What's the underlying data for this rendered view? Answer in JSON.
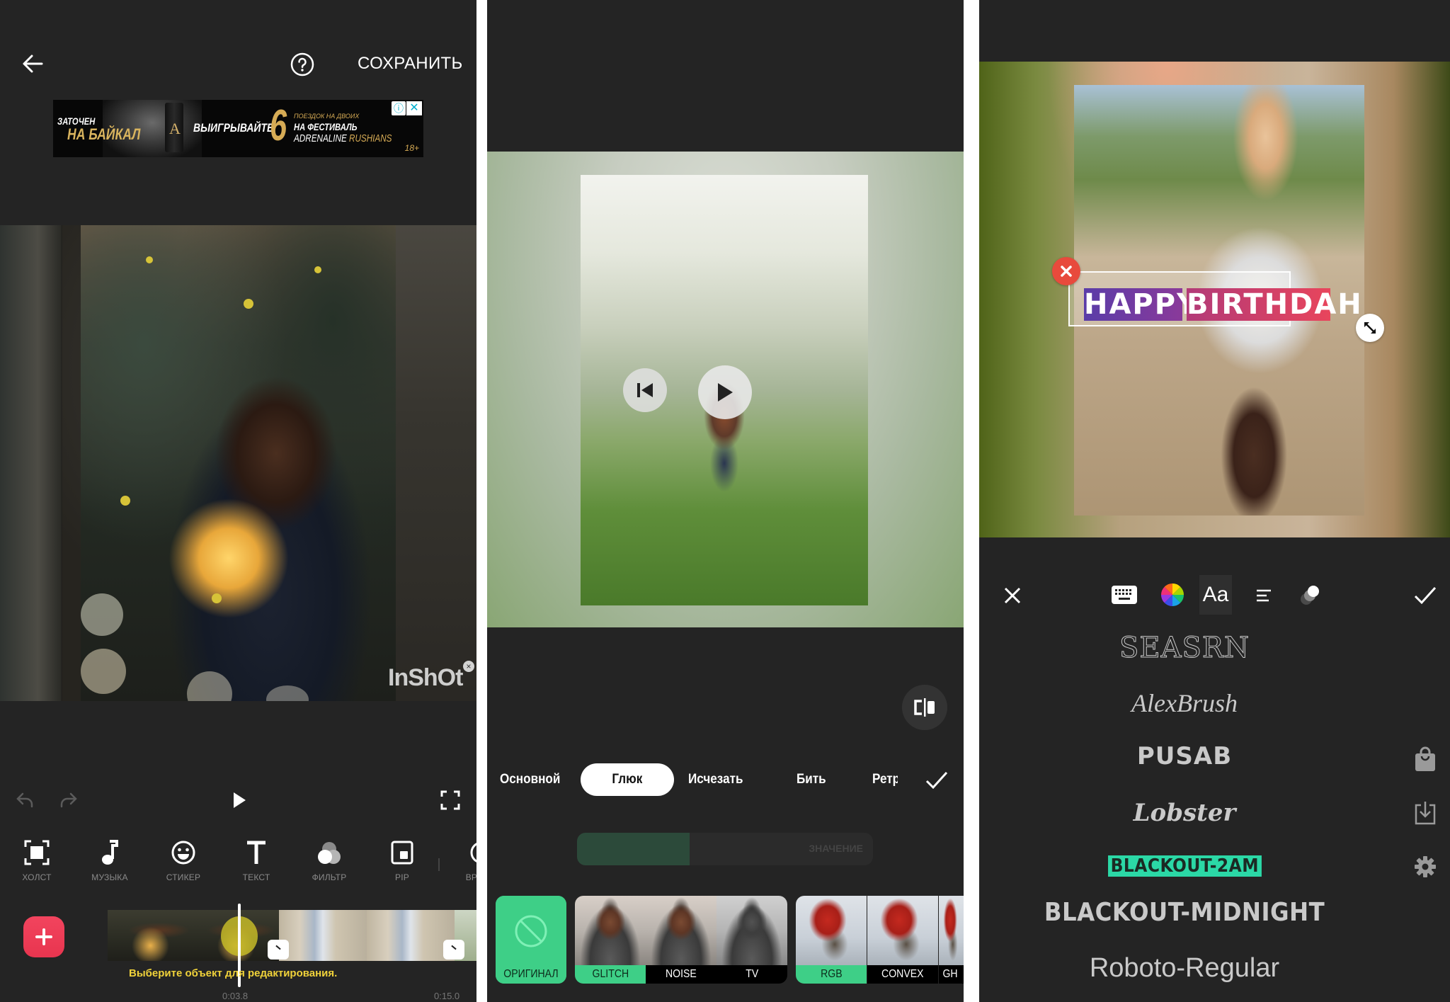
{
  "panel_editor": {
    "header": {
      "back_icon": "arrow-left-icon",
      "help_icon": "help-circle-icon",
      "save_label": "СОХРАНИТЬ"
    },
    "ad_banner": {
      "line1": "ЗАТОЧЕН",
      "line2": "НА БАЙКАЛ",
      "cta": "ВЫИГРЫВАЙТЕ",
      "number": "6",
      "promo_small": "ПОЕЗДОК НА ДВОИХ",
      "promo_mid": "НА ФЕСТИВАЛЬ",
      "promo_brand": "ADRENALINE",
      "promo_brand_accent": "RUSHIANS",
      "age_rating": "18+",
      "info_icon": "ⓘ",
      "close_icon": "✕",
      "can_letter": "A"
    },
    "preview": {
      "watermark": "InShOt",
      "watermark_close": "×"
    },
    "controls": {
      "undo_icon": "undo-icon",
      "redo_icon": "redo-icon",
      "play_icon": "play-icon",
      "fullscreen_icon": "fullscreen-icon"
    },
    "toolbar": [
      {
        "label": "ХОЛСТ",
        "icon": "canvas-icon"
      },
      {
        "label": "МУЗЫКА",
        "icon": "music-note-icon"
      },
      {
        "label": "СТИКЕР",
        "icon": "smiley-icon"
      },
      {
        "label": "ТЕКСТ",
        "icon": "text-icon"
      },
      {
        "label": "ФИЛЬТР",
        "icon": "filter-icon"
      },
      {
        "label": "PIP",
        "icon": "pip-icon"
      },
      {
        "label": "ВРЕ",
        "icon": "clock-icon"
      }
    ],
    "timeline": {
      "add_label": "+",
      "hint": "Выберите объект для редактирования.",
      "current_time": "0:03.8",
      "total_time": "0:15.0"
    }
  },
  "panel_effects": {
    "tabs": [
      {
        "label": "Основной",
        "active": false
      },
      {
        "label": "Глюк",
        "active": true
      },
      {
        "label": "Исчезать",
        "active": false
      },
      {
        "label": "Бить",
        "active": false
      },
      {
        "label": "Ретро",
        "active": false
      }
    ],
    "slider": {
      "label": "ЗНАЧЕНИЕ",
      "value_fraction": 0.38
    },
    "effects": [
      {
        "label": "ОРИГИНАЛ",
        "selected": true,
        "group": 0
      },
      {
        "label": "GLITCH",
        "selected": false,
        "group": 1
      },
      {
        "label": "NOISE",
        "selected": false,
        "group": 1
      },
      {
        "label": "TV",
        "selected": false,
        "group": 1
      },
      {
        "label": "RGB",
        "selected": false,
        "group": 2
      },
      {
        "label": "CONVEX",
        "selected": false,
        "group": 2
      },
      {
        "label": "GH",
        "selected": false,
        "group": 2
      }
    ]
  },
  "panel_text": {
    "overlay_text": {
      "word1": "HAPPY",
      "word2": "BIRTHDAH",
      "delete_icon": "✕"
    },
    "toolbar": {
      "close_icon": "close-icon",
      "keyboard_icon": "keyboard-icon",
      "color_icon": "color-wheel-icon",
      "font_label": "Aa",
      "align_icon": "align-left-icon",
      "shadow_icon": "shadow-icon",
      "confirm_icon": "checkmark-icon"
    },
    "fonts": [
      {
        "name": "SEASRN",
        "selected": false
      },
      {
        "name": "AlexBrush",
        "selected": false
      },
      {
        "name": "PUSAB",
        "selected": false
      },
      {
        "name": "Lobster",
        "selected": false
      },
      {
        "name": "BLACKOUT-2AM",
        "selected": true
      },
      {
        "name": "BLACKOUT-MIDNIGHT",
        "selected": false
      },
      {
        "name": "Roboto-Regular",
        "selected": false
      }
    ],
    "side_icons": [
      "shopping-bag-icon",
      "import-icon",
      "gear-icon"
    ]
  },
  "colors": {
    "panel_bg": "#242424",
    "accent_green": "#3ecf87",
    "accent_red": "#f2445e",
    "hint_yellow": "#f0d23a",
    "selected_font_bg": "#2bd8a6"
  }
}
